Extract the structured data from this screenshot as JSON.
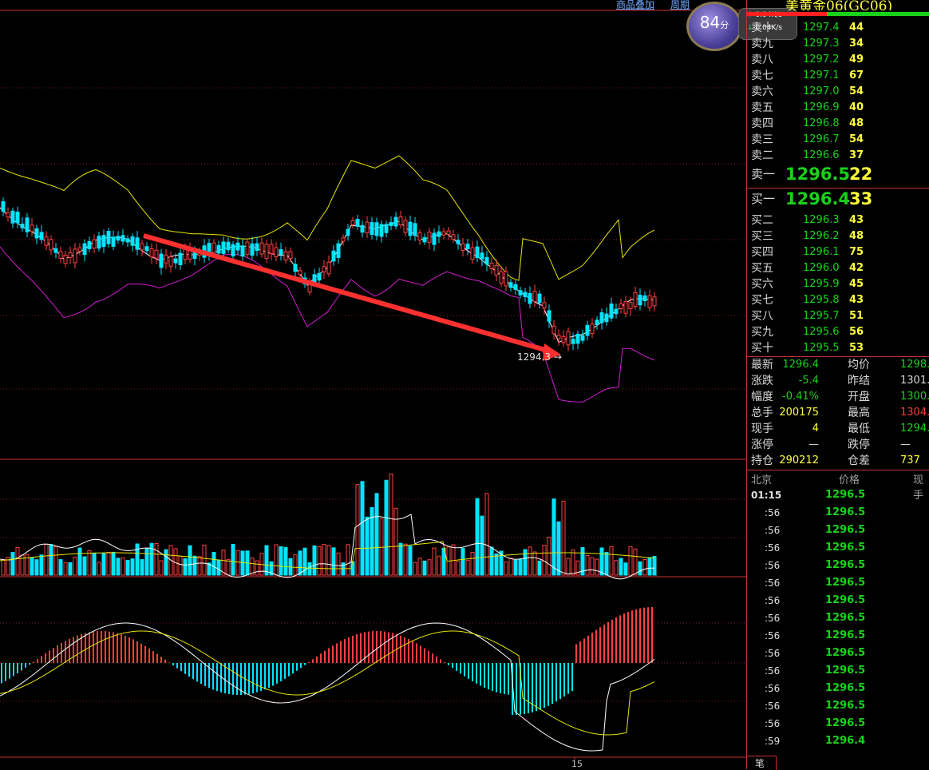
{
  "header": {
    "link1": "商品叠加",
    "link2": "周期",
    "symbol": "美黄金06(GC06)"
  },
  "speed_badge": {
    "score": "84",
    "unit": "分",
    "up_rate": "0.04K/s",
    "down_rate": "0.04K/s"
  },
  "chart": {
    "low_label": "1294.3",
    "x_tick": "15"
  },
  "order_book": {
    "asks": [
      {
        "label": "卖十",
        "price": "1297.4",
        "vol": "44"
      },
      {
        "label": "卖九",
        "price": "1297.3",
        "vol": "34"
      },
      {
        "label": "卖八",
        "price": "1297.2",
        "vol": "49"
      },
      {
        "label": "卖七",
        "price": "1297.1",
        "vol": "67"
      },
      {
        "label": "卖六",
        "price": "1297.0",
        "vol": "54"
      },
      {
        "label": "卖五",
        "price": "1296.9",
        "vol": "40"
      },
      {
        "label": "卖四",
        "price": "1296.8",
        "vol": "48"
      },
      {
        "label": "卖三",
        "price": "1296.7",
        "vol": "54"
      },
      {
        "label": "卖二",
        "price": "1296.6",
        "vol": "37"
      },
      {
        "label": "卖一",
        "price": "1296.5",
        "vol": "22"
      }
    ],
    "bids": [
      {
        "label": "买一",
        "price": "1296.4",
        "vol": "33"
      },
      {
        "label": "买二",
        "price": "1296.3",
        "vol": "43"
      },
      {
        "label": "买三",
        "price": "1296.2",
        "vol": "48"
      },
      {
        "label": "买四",
        "price": "1296.1",
        "vol": "75"
      },
      {
        "label": "买五",
        "price": "1296.0",
        "vol": "42"
      },
      {
        "label": "买六",
        "price": "1295.9",
        "vol": "45"
      },
      {
        "label": "买七",
        "price": "1295.8",
        "vol": "43"
      },
      {
        "label": "买八",
        "price": "1295.7",
        "vol": "51"
      },
      {
        "label": "买九",
        "price": "1295.6",
        "vol": "56"
      },
      {
        "label": "买十",
        "price": "1295.5",
        "vol": "53"
      }
    ]
  },
  "stats": [
    {
      "l1": "最新",
      "v1": "1296.4",
      "c1": "#19d219",
      "l2": "均价",
      "v2": "1298.",
      "c2": "#19d219"
    },
    {
      "l1": "涨跌",
      "v1": "-5.4",
      "c1": "#19d219",
      "l2": "昨结",
      "v2": "1301.",
      "c2": "#d8d8d8"
    },
    {
      "l1": "幅度",
      "v1": "-0.41%",
      "c1": "#19d219",
      "l2": "开盘",
      "v2": "1300.",
      "c2": "#19d219"
    },
    {
      "l1": "总手",
      "v1": "200175",
      "c1": "#ffff3c",
      "l2": "最高",
      "v2": "1304.",
      "c2": "#ff3c3c"
    },
    {
      "l1": "现手",
      "v1": "4",
      "c1": "#ffff3c",
      "l2": "最低",
      "v2": "1294.",
      "c2": "#19d219"
    },
    {
      "l1": "涨停",
      "v1": "—",
      "c1": "#d8d8d8",
      "l2": "跌停",
      "v2": "—",
      "c2": "#d8d8d8"
    },
    {
      "l1": "持仓",
      "v1": "290212",
      "c1": "#ffff3c",
      "l2": "仓差",
      "v2": "737",
      "c2": "#ffff3c"
    }
  ],
  "ticks": {
    "headers": [
      "北京",
      "价格",
      "现手"
    ],
    "rows": [
      {
        "t": "01:15",
        "p": "1296.5"
      },
      {
        "t": ":56",
        "p": "1296.5"
      },
      {
        "t": ":56",
        "p": "1296.5"
      },
      {
        "t": ":56",
        "p": "1296.5"
      },
      {
        "t": ":56",
        "p": "1296.5"
      },
      {
        "t": ":56",
        "p": "1296.5"
      },
      {
        "t": ":56",
        "p": "1296.5"
      },
      {
        "t": ":56",
        "p": "1296.5"
      },
      {
        "t": ":56",
        "p": "1296.5"
      },
      {
        "t": ":56",
        "p": "1296.5"
      },
      {
        "t": ":56",
        "p": "1296.5"
      },
      {
        "t": ":56",
        "p": "1296.5"
      },
      {
        "t": ":56",
        "p": "1296.5"
      },
      {
        "t": ":56",
        "p": "1296.5"
      },
      {
        "t": ":59",
        "p": "1296.4"
      }
    ],
    "tab_label": "笔"
  },
  "colors": {
    "up": "#ff4040",
    "down": "#00e5ff",
    "upper_band": "#e6e600",
    "lower_band": "#d21ed2",
    "mid_band": "#ffffff",
    "arrow": "#ff3030"
  }
}
